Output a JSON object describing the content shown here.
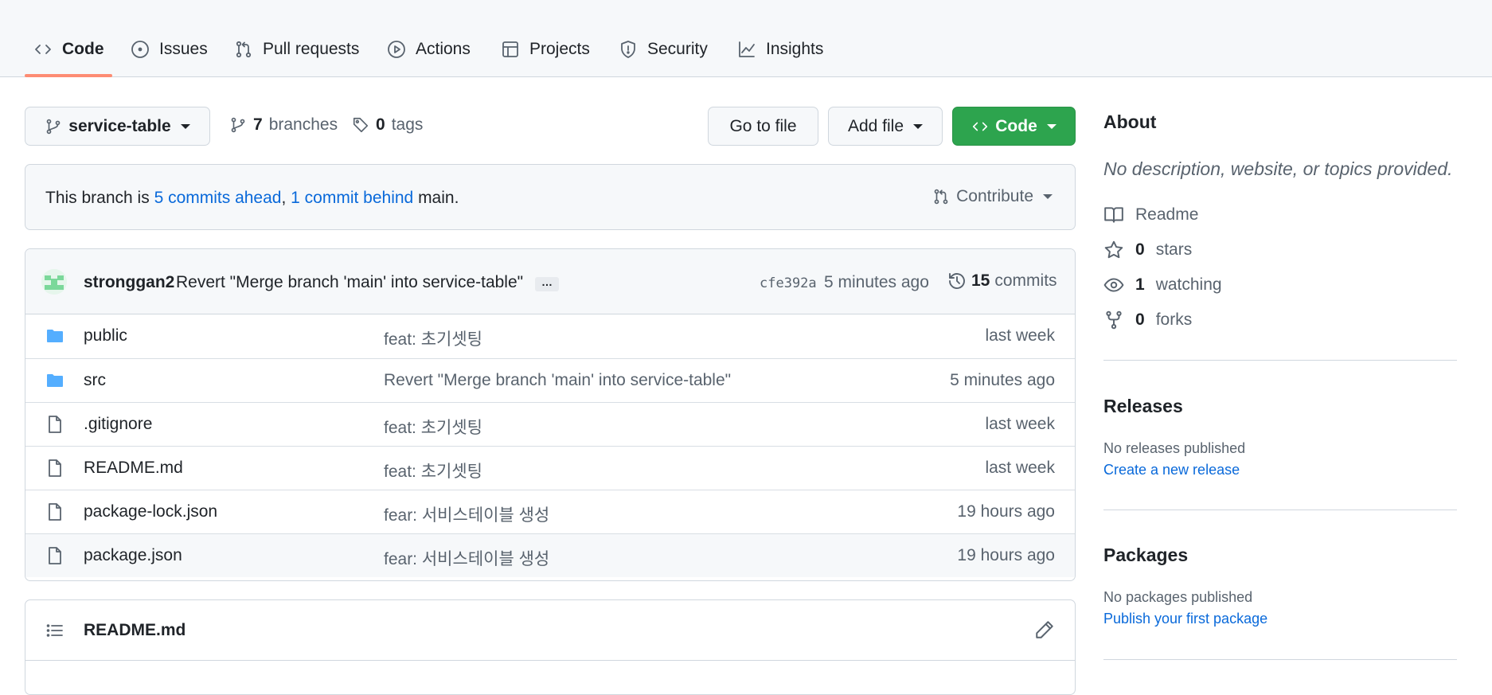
{
  "nav": {
    "tabs": [
      {
        "label": "Code",
        "icon": "code-icon",
        "selected": true
      },
      {
        "label": "Issues",
        "icon": "issue-opened-icon"
      },
      {
        "label": "Pull requests",
        "icon": "git-pull-request-icon"
      },
      {
        "label": "Actions",
        "icon": "play-icon"
      },
      {
        "label": "Projects",
        "icon": "table-icon"
      },
      {
        "label": "Security",
        "icon": "shield-icon"
      },
      {
        "label": "Insights",
        "icon": "graph-icon"
      }
    ]
  },
  "toolbar": {
    "branch": "service-table",
    "branches_count": "7",
    "branches_label": "branches",
    "tags_count": "0",
    "tags_label": "tags",
    "go_to_file": "Go to file",
    "add_file": "Add file",
    "code": "Code"
  },
  "branch_info": {
    "prefix": "This branch is ",
    "ahead": "5 commits ahead",
    "sep": ", ",
    "behind": "1 commit behind",
    "suffix": " main.",
    "contribute": "Contribute"
  },
  "latest_commit": {
    "author": "stronggan2",
    "message": "Revert \"Merge branch 'main' into service-table\"",
    "ellipsis": "…",
    "sha": "cfe392a",
    "time": "5 minutes ago",
    "commits_count": "15",
    "commits_label": "commits"
  },
  "files": [
    {
      "name": "public",
      "type": "dir",
      "message": "feat: 초기셋팅",
      "time": "last week"
    },
    {
      "name": "src",
      "type": "dir",
      "message": "Revert \"Merge branch 'main' into service-table\"",
      "time": "5 minutes ago"
    },
    {
      "name": ".gitignore",
      "type": "file",
      "message": "feat: 초기셋팅",
      "time": "last week"
    },
    {
      "name": "README.md",
      "type": "file",
      "message": "feat: 초기셋팅",
      "time": "last week"
    },
    {
      "name": "package-lock.json",
      "type": "file",
      "message": "fear: 서비스테이블 생성",
      "time": "19 hours ago"
    },
    {
      "name": "package.json",
      "type": "file",
      "message": "fear: 서비스테이블 생성",
      "time": "19 hours ago"
    }
  ],
  "readme": {
    "title": "README.md"
  },
  "sidebar": {
    "about_heading": "About",
    "description": "No description, website, or topics provided.",
    "readme": "Readme",
    "stars_count": "0",
    "stars_label": "stars",
    "watching_count": "1",
    "watching_label": "watching",
    "forks_count": "0",
    "forks_label": "forks",
    "releases_heading": "Releases",
    "releases_text": "No releases published",
    "releases_link": "Create a new release",
    "packages_heading": "Packages",
    "packages_text": "No packages published",
    "packages_link": "Publish your first package"
  },
  "colors": {
    "accent_link": "#0969da",
    "code_button": "#2da44e",
    "selected_tab_underline": "#fd8c73",
    "folder": "#54aeff"
  }
}
